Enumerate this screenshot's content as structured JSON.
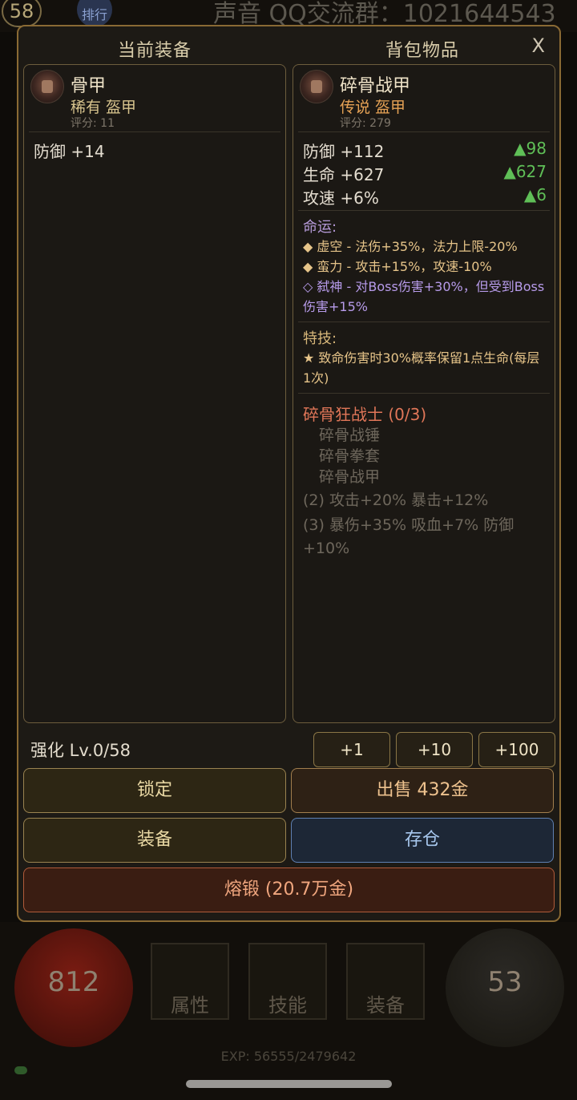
{
  "background": {
    "level": "58",
    "rank_label": "排行",
    "qq_text": "声音 QQ交流群：1021644543",
    "hp_value": "812",
    "mp_value": "53",
    "tabs": [
      "属性",
      "技能",
      "装备"
    ],
    "exp": "EXP: 56555/2479642"
  },
  "modal": {
    "left_header": "当前装备",
    "right_header": "背包物品",
    "close_label": "X"
  },
  "current_item": {
    "name": "骨甲",
    "type": "稀有 盔甲",
    "score": "评分: 11",
    "stats": [
      {
        "label": "防御 +14"
      }
    ]
  },
  "bag_item": {
    "name": "碎骨战甲",
    "type": "传说 盔甲",
    "score": "评分: 279",
    "stats": [
      {
        "label": "防御 +112",
        "diff": "▲98"
      },
      {
        "label": "生命 +627",
        "diff": "▲627"
      },
      {
        "label": "攻速 +6%",
        "diff": "▲6"
      }
    ],
    "fate_title": "命运:",
    "fate": [
      {
        "text": "◆ 虚空 - 法伤+35%，法力上限-20%",
        "color": "gold"
      },
      {
        "text": "◆ 蛮力 - 攻击+15%，攻速-10%",
        "color": "gold"
      },
      {
        "text": "◇ 弑神 - 对Boss伤害+30%，但受到Boss伤害+15%",
        "color": "purple"
      }
    ],
    "skill_title": "特技:",
    "skill_text": "★ 致命伤害时30%概率保留1点生命(每层1次)",
    "set_title": "碎骨狂战士 (0/3)",
    "set_items": [
      "碎骨战锤",
      "碎骨拳套",
      "碎骨战甲"
    ],
    "set_bonus_2": "(2) 攻击+20% 暴击+12%",
    "set_bonus_3": "(3) 暴伤+35% 吸血+7% 防御+10%"
  },
  "actions": {
    "enhance_label": "强化 Lv.0/58",
    "plus1": "+1",
    "plus10": "+10",
    "plus100": "+100",
    "lock": "锁定",
    "sell": "出售 432金",
    "equip": "装备",
    "store": "存仓",
    "forge": "熔锻 (20.7万金)"
  }
}
